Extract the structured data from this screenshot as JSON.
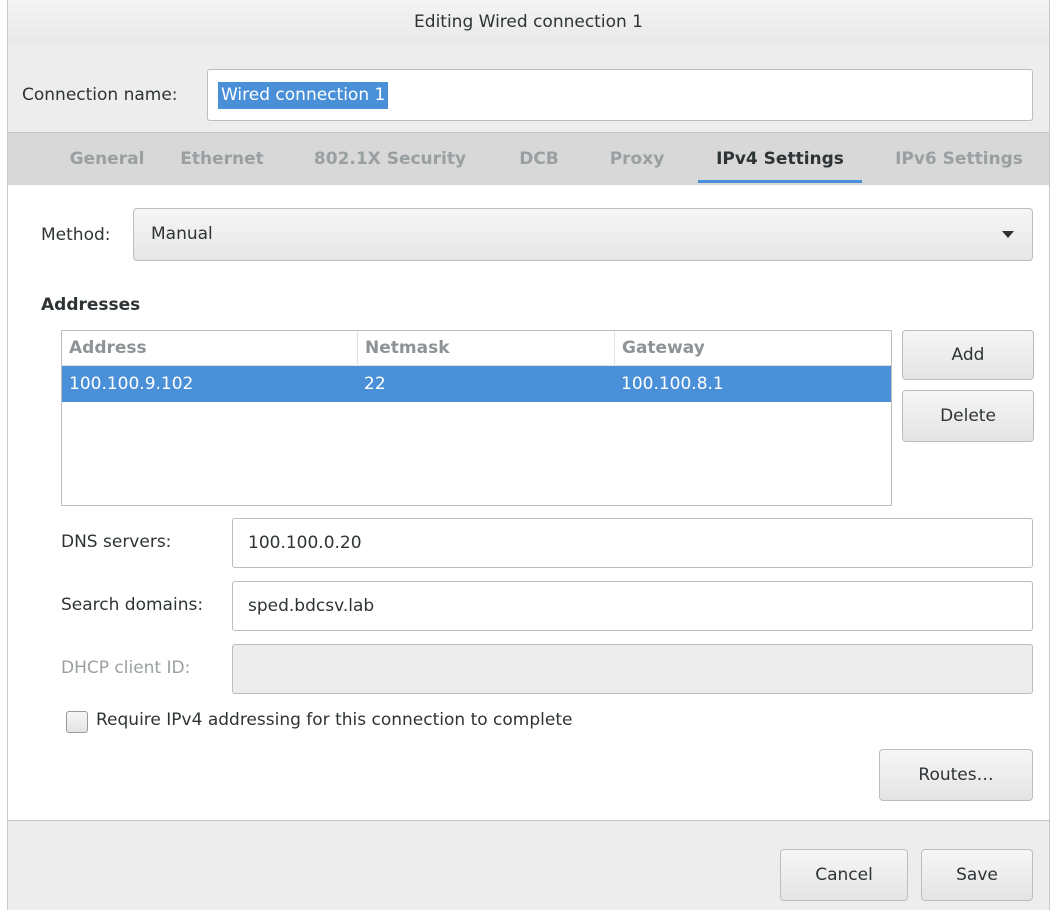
{
  "window": {
    "title": "Editing Wired connection 1"
  },
  "connection": {
    "label": "Connection name:",
    "value": "Wired connection 1"
  },
  "tabs": [
    {
      "label": "General"
    },
    {
      "label": "Ethernet"
    },
    {
      "label": "802.1X Security"
    },
    {
      "label": "DCB"
    },
    {
      "label": "Proxy"
    },
    {
      "label": "IPv4 Settings"
    },
    {
      "label": "IPv6 Settings"
    }
  ],
  "active_tab": "IPv4 Settings",
  "method": {
    "label": "Method:",
    "value": "Manual"
  },
  "addresses": {
    "heading": "Addresses",
    "columns": [
      "Address",
      "Netmask",
      "Gateway"
    ],
    "rows": [
      {
        "address": "100.100.9.102",
        "netmask": "22",
        "gateway": "100.100.8.1"
      }
    ],
    "add_label": "Add",
    "delete_label": "Delete"
  },
  "dns": {
    "label": "DNS servers:",
    "value": "100.100.0.20"
  },
  "search": {
    "label": "Search domains:",
    "value": "sped.bdcsv.lab"
  },
  "dhcp": {
    "label": "DHCP client ID:",
    "value": ""
  },
  "require": {
    "label": "Require IPv4 addressing for this connection to complete",
    "checked": false
  },
  "routes_label": "Routes…",
  "footer": {
    "cancel_label": "Cancel",
    "save_label": "Save"
  },
  "colors": {
    "accent": "#4a90d9",
    "window_bg": "#ededed",
    "panel_bg": "#ffffff"
  }
}
